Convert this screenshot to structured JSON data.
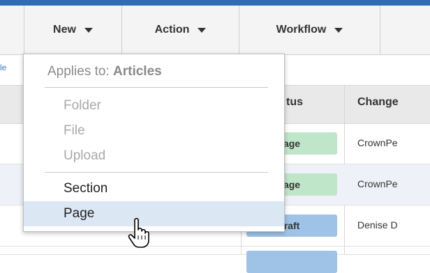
{
  "toolbar": {
    "buttons": [
      {
        "label": "New"
      },
      {
        "label": "Action"
      },
      {
        "label": "Workflow"
      }
    ]
  },
  "grid": {
    "left_link": "le",
    "columns": {
      "status": "tus",
      "changed": "Change"
    },
    "rows": [
      {
        "status": "age",
        "status_color": "#bfe6c9",
        "changed_by": "CrownPe"
      },
      {
        "status": "age",
        "status_color": "#bfe6c9",
        "changed_by": "CrownPe"
      },
      {
        "status": "raft",
        "status_color": "#9ec3e6",
        "changed_by": "Denise D"
      },
      {
        "status": "",
        "status_color": "#9ec3e6",
        "changed_by": ""
      }
    ]
  },
  "menu": {
    "heading_prefix": "Applies to: ",
    "heading_bold": "Articles",
    "items": [
      {
        "label": "Folder",
        "enabled": false
      },
      {
        "label": "File",
        "enabled": false
      },
      {
        "label": "Upload",
        "enabled": false
      },
      {
        "label": "Section",
        "enabled": true
      },
      {
        "label": "Page",
        "enabled": true,
        "hover": true
      }
    ]
  },
  "colors": {
    "accent": "#2e6cb5",
    "hover": "#dbe7f3"
  }
}
